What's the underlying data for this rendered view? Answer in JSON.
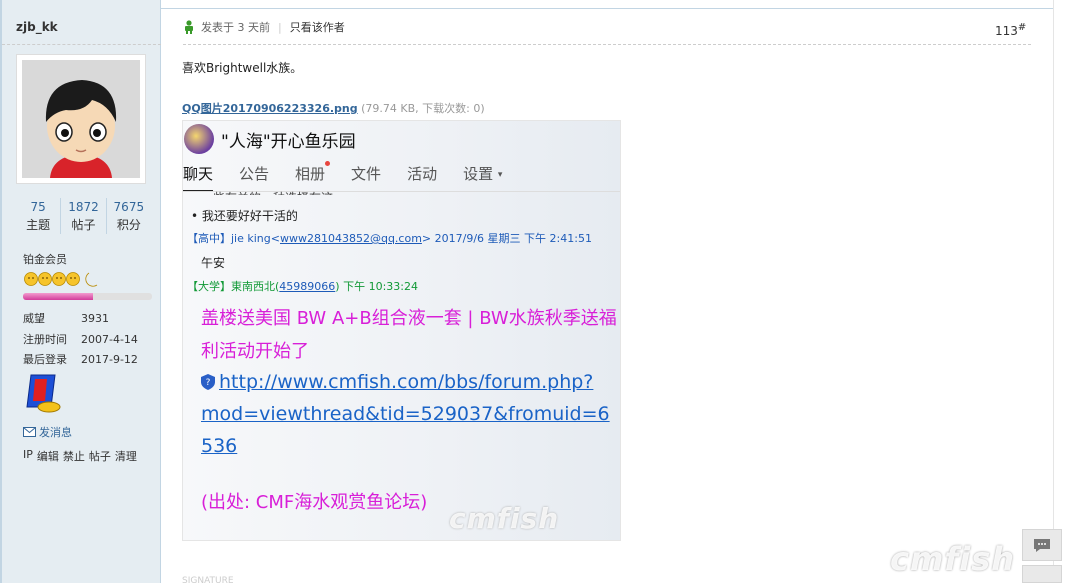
{
  "author": {
    "username": "zjb_kk",
    "stats": [
      {
        "value": "75",
        "label": "主题"
      },
      {
        "value": "1872",
        "label": "帖子"
      },
      {
        "value": "7675",
        "label": "积分"
      }
    ],
    "rank": "铂金会员",
    "rank_progress": 0.54,
    "info": [
      {
        "k": "威望",
        "v": "3931"
      },
      {
        "k": "注册时间",
        "v": "2007-4-14"
      },
      {
        "k": "最后登录",
        "v": "2017-9-12"
      }
    ],
    "send_message": "发消息",
    "admin_links": [
      "IP",
      "编辑",
      "禁止",
      "帖子",
      "清理"
    ]
  },
  "post": {
    "posted_label": "发表于 3 天前",
    "only_author": "只看该作者",
    "floor": "113",
    "floor_sup": "#",
    "text": "喜欢Brightwell水族。",
    "attachment_name": "QQ图片20170906223326.png",
    "attachment_meta": "(79.74 KB, 下载次数: 0)"
  },
  "qq": {
    "group_name": "\"人海\"开心鱼乐园",
    "tabs": [
      "聊天",
      "公告",
      "相册",
      "文件",
      "活动",
      "设置"
    ],
    "cut_text": "一些有关的一种选择在这",
    "bullet_line": "我还要好好干活的",
    "msg1_tag": "【高中】",
    "msg1_name": "jie king",
    "msg1_lt": "<",
    "msg1_email": "www281043852@qq.com",
    "msg1_gt": ">",
    "msg1_time": "2017/9/6 星期三 下午 2:41:51",
    "msg1_text": "午安",
    "msg2_tag": "【大学】",
    "msg2_name": "東南西北",
    "msg2_lp": "(",
    "msg2_qq": "45989066",
    "msg2_rp": ")",
    "msg2_time": "下午 10:33:24",
    "promo_text": "盖楼送美国 BW A+B组合液一套 | BW水族秋季送福利活动开始了",
    "link_text": "http://www.cmfish.com/bbs/forum.php?mod=viewthread&tid=529037&fromuid=6536",
    "source_text": "(出处: CMF海水观赏鱼论坛)",
    "watermark": "cmfish"
  },
  "page_watermark": "cmfish",
  "signature_hint": "SIGNATURE",
  "colors": {
    "accent": "#336699",
    "promo": "#d81fd8",
    "link": "#1a63c7"
  }
}
